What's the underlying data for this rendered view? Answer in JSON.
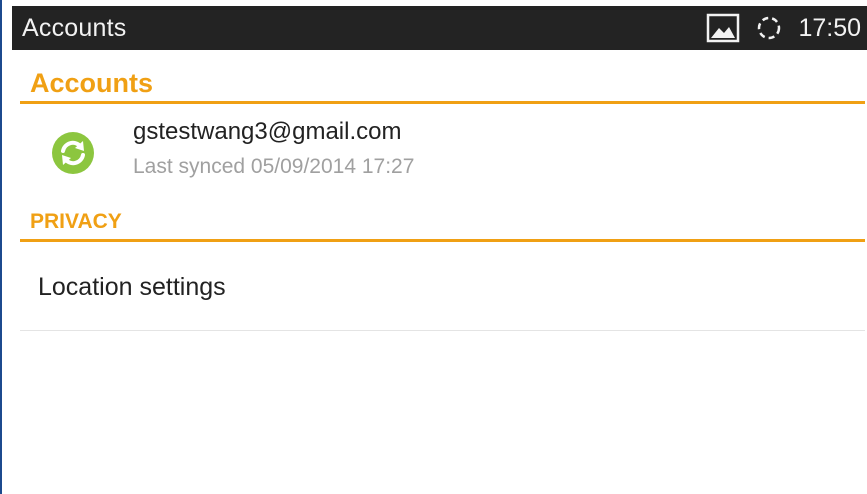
{
  "status_bar": {
    "title": "Accounts",
    "time": "17:50",
    "icons": [
      "image-icon",
      "sync-spinner-icon"
    ]
  },
  "sections": {
    "accounts": {
      "header": "Accounts"
    },
    "privacy": {
      "header": "PRIVACY"
    }
  },
  "account": {
    "email": "gstestwang3@gmail.com",
    "last_synced": "Last synced 05/09/2014 17:27",
    "icon": "sync-icon"
  },
  "privacy_items": [
    {
      "label": "Location settings"
    }
  ],
  "colors": {
    "accent": "#f0a014",
    "status_bar": "#232323",
    "sync_green": "#8cc63f"
  }
}
